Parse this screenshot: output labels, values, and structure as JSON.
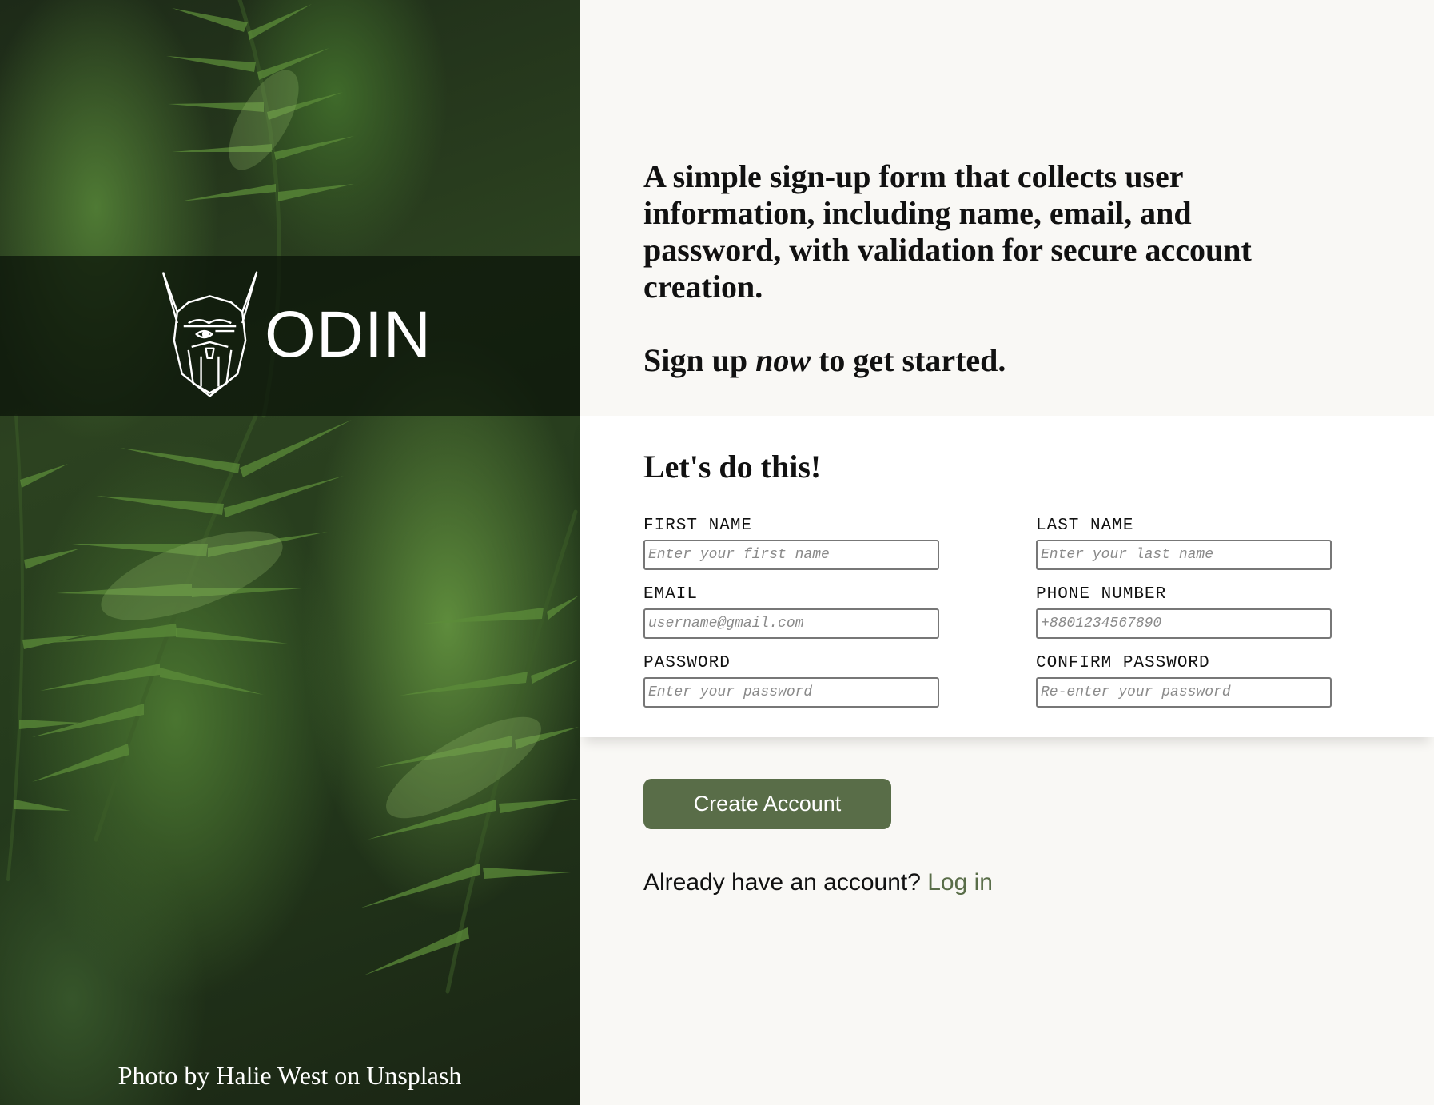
{
  "brand": {
    "logo_text": "ODIN",
    "photo_credit": "Photo by Halie West on Unsplash"
  },
  "intro": {
    "description": "A simple sign-up form that collects user information, including name, email, and password, with validation for secure account creation.",
    "cta_before": "Sign up ",
    "cta_emphasis": "now",
    "cta_after": " to get started."
  },
  "form": {
    "title": "Let's do this!",
    "fields": {
      "first_name": {
        "label": "FIRST NAME",
        "placeholder": "Enter your first name"
      },
      "last_name": {
        "label": "LAST NAME",
        "placeholder": "Enter your last name"
      },
      "email": {
        "label": "EMAIL",
        "placeholder": "username@gmail.com"
      },
      "phone": {
        "label": "PHONE NUMBER",
        "placeholder": "+8801234567890"
      },
      "password": {
        "label": "PASSWORD",
        "placeholder": "Enter your password"
      },
      "confirm_password": {
        "label": "CONFIRM PASSWORD",
        "placeholder": "Re-enter your password"
      }
    }
  },
  "actions": {
    "create_label": "Create Account",
    "login_prompt": "Already have an account? ",
    "login_link": "Log in"
  },
  "colors": {
    "accent": "#596d48",
    "page_background": "#f9f8f5",
    "card_background": "#ffffff"
  },
  "icons": {
    "logo": "viking-helmet-logo-icon"
  }
}
